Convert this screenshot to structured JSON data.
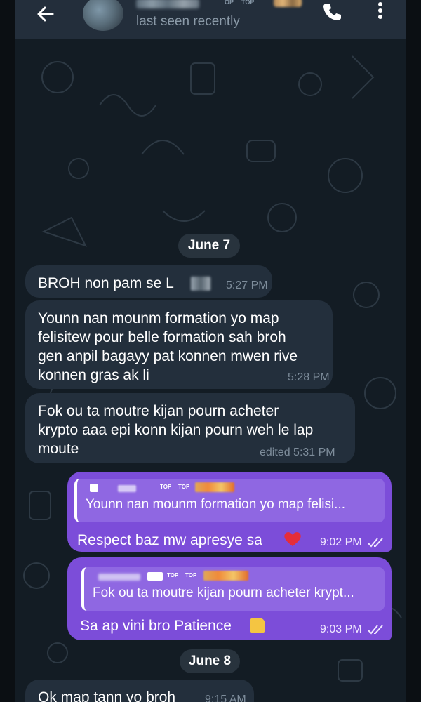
{
  "header": {
    "name_badges": [
      "OP",
      "TOP"
    ],
    "status": "last seen recently",
    "icons": {
      "back": "arrow-left-icon",
      "call": "phone-icon",
      "menu": "more-vert-icon"
    }
  },
  "colors": {
    "header_bg": "#232e3b",
    "chat_bg": "#131c24",
    "incoming_bubble": "#232f3c",
    "outgoing_bubble": "#7c4dd9",
    "reply_box": "#8f67e2"
  },
  "dates": {
    "first": "June 7",
    "second": "June 8"
  },
  "messages": [
    {
      "type": "incoming",
      "text": "BROH non pam se L",
      "time": "5:27 PM"
    },
    {
      "type": "incoming",
      "text": "Younn nan mounm formation yo map\nfelisitew pour belle formation sah broh\ngen anpil bagayy pat konnen mwen rive\nkonnen gras ak li",
      "time": "5:28 PM"
    },
    {
      "type": "incoming",
      "text": "Fok ou ta moutre kijan pourn acheter\nkrypto aaa epi konn kijan pourn  weh le lap\nmoute",
      "time": "edited 5:31 PM"
    },
    {
      "type": "outgoing",
      "reply_badges": [
        "TOP",
        "TOP"
      ],
      "reply_text": "Younn nan mounm formation yo map felisi...",
      "text": "Respect baz mw apresye sa",
      "emoji": "heart",
      "time": "9:02 PM",
      "read": true
    },
    {
      "type": "outgoing",
      "reply_badges": [
        "TOP",
        "TOP"
      ],
      "reply_text": "Fok ou ta moutre kijan pourn acheter krypt...",
      "text": "Sa ap vini bro Patience",
      "emoji": "thumbs-up",
      "time": "9:03 PM",
      "read": true
    },
    {
      "type": "incoming",
      "text": "Ok map tann yo broh",
      "time": "9:15 AM"
    }
  ]
}
